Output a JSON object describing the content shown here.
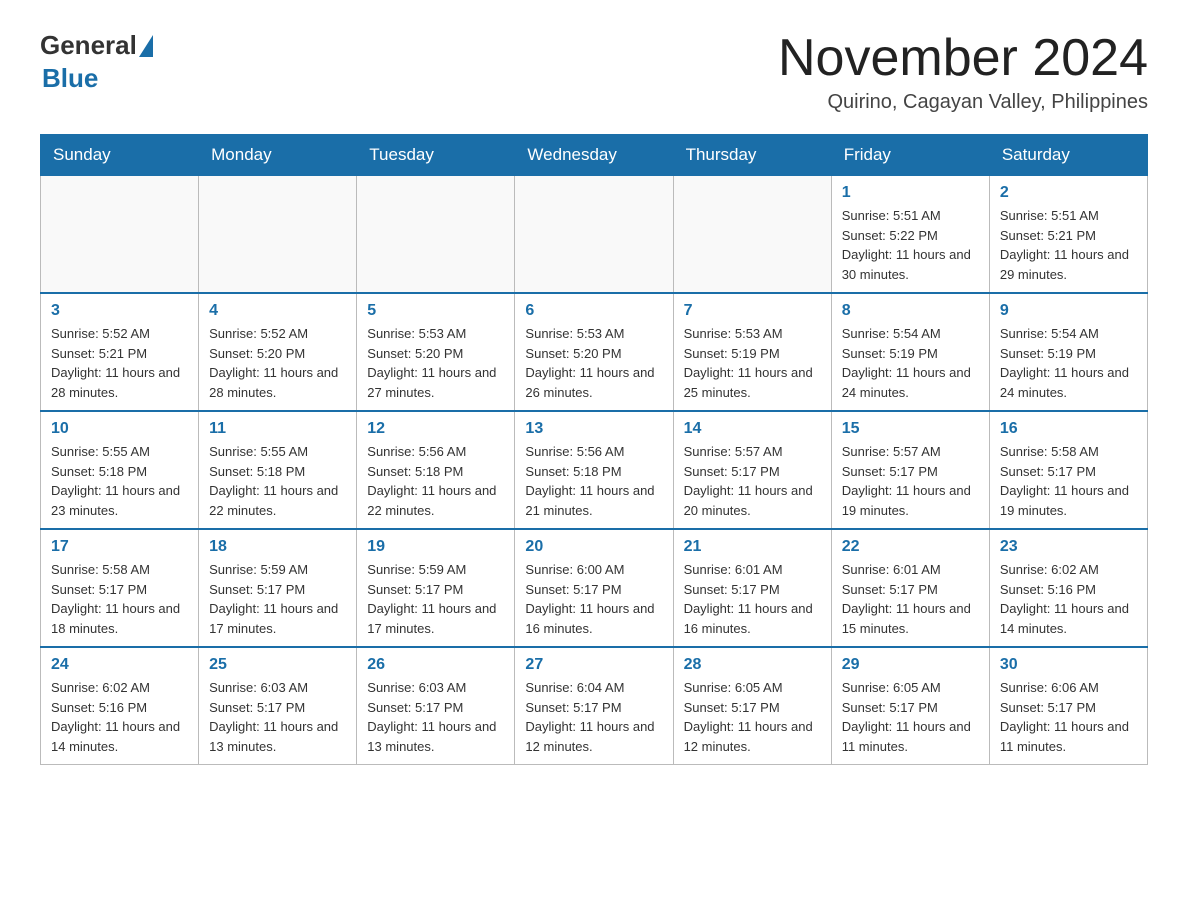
{
  "logo": {
    "general": "General",
    "blue": "Blue"
  },
  "title": "November 2024",
  "location": "Quirino, Cagayan Valley, Philippines",
  "days_of_week": [
    "Sunday",
    "Monday",
    "Tuesday",
    "Wednesday",
    "Thursday",
    "Friday",
    "Saturday"
  ],
  "weeks": [
    {
      "days": [
        {
          "num": "",
          "info": ""
        },
        {
          "num": "",
          "info": ""
        },
        {
          "num": "",
          "info": ""
        },
        {
          "num": "",
          "info": ""
        },
        {
          "num": "",
          "info": ""
        },
        {
          "num": "1",
          "info": "Sunrise: 5:51 AM\nSunset: 5:22 PM\nDaylight: 11 hours and 30 minutes."
        },
        {
          "num": "2",
          "info": "Sunrise: 5:51 AM\nSunset: 5:21 PM\nDaylight: 11 hours and 29 minutes."
        }
      ]
    },
    {
      "days": [
        {
          "num": "3",
          "info": "Sunrise: 5:52 AM\nSunset: 5:21 PM\nDaylight: 11 hours and 28 minutes."
        },
        {
          "num": "4",
          "info": "Sunrise: 5:52 AM\nSunset: 5:20 PM\nDaylight: 11 hours and 28 minutes."
        },
        {
          "num": "5",
          "info": "Sunrise: 5:53 AM\nSunset: 5:20 PM\nDaylight: 11 hours and 27 minutes."
        },
        {
          "num": "6",
          "info": "Sunrise: 5:53 AM\nSunset: 5:20 PM\nDaylight: 11 hours and 26 minutes."
        },
        {
          "num": "7",
          "info": "Sunrise: 5:53 AM\nSunset: 5:19 PM\nDaylight: 11 hours and 25 minutes."
        },
        {
          "num": "8",
          "info": "Sunrise: 5:54 AM\nSunset: 5:19 PM\nDaylight: 11 hours and 24 minutes."
        },
        {
          "num": "9",
          "info": "Sunrise: 5:54 AM\nSunset: 5:19 PM\nDaylight: 11 hours and 24 minutes."
        }
      ]
    },
    {
      "days": [
        {
          "num": "10",
          "info": "Sunrise: 5:55 AM\nSunset: 5:18 PM\nDaylight: 11 hours and 23 minutes."
        },
        {
          "num": "11",
          "info": "Sunrise: 5:55 AM\nSunset: 5:18 PM\nDaylight: 11 hours and 22 minutes."
        },
        {
          "num": "12",
          "info": "Sunrise: 5:56 AM\nSunset: 5:18 PM\nDaylight: 11 hours and 22 minutes."
        },
        {
          "num": "13",
          "info": "Sunrise: 5:56 AM\nSunset: 5:18 PM\nDaylight: 11 hours and 21 minutes."
        },
        {
          "num": "14",
          "info": "Sunrise: 5:57 AM\nSunset: 5:17 PM\nDaylight: 11 hours and 20 minutes."
        },
        {
          "num": "15",
          "info": "Sunrise: 5:57 AM\nSunset: 5:17 PM\nDaylight: 11 hours and 19 minutes."
        },
        {
          "num": "16",
          "info": "Sunrise: 5:58 AM\nSunset: 5:17 PM\nDaylight: 11 hours and 19 minutes."
        }
      ]
    },
    {
      "days": [
        {
          "num": "17",
          "info": "Sunrise: 5:58 AM\nSunset: 5:17 PM\nDaylight: 11 hours and 18 minutes."
        },
        {
          "num": "18",
          "info": "Sunrise: 5:59 AM\nSunset: 5:17 PM\nDaylight: 11 hours and 17 minutes."
        },
        {
          "num": "19",
          "info": "Sunrise: 5:59 AM\nSunset: 5:17 PM\nDaylight: 11 hours and 17 minutes."
        },
        {
          "num": "20",
          "info": "Sunrise: 6:00 AM\nSunset: 5:17 PM\nDaylight: 11 hours and 16 minutes."
        },
        {
          "num": "21",
          "info": "Sunrise: 6:01 AM\nSunset: 5:17 PM\nDaylight: 11 hours and 16 minutes."
        },
        {
          "num": "22",
          "info": "Sunrise: 6:01 AM\nSunset: 5:17 PM\nDaylight: 11 hours and 15 minutes."
        },
        {
          "num": "23",
          "info": "Sunrise: 6:02 AM\nSunset: 5:16 PM\nDaylight: 11 hours and 14 minutes."
        }
      ]
    },
    {
      "days": [
        {
          "num": "24",
          "info": "Sunrise: 6:02 AM\nSunset: 5:16 PM\nDaylight: 11 hours and 14 minutes."
        },
        {
          "num": "25",
          "info": "Sunrise: 6:03 AM\nSunset: 5:17 PM\nDaylight: 11 hours and 13 minutes."
        },
        {
          "num": "26",
          "info": "Sunrise: 6:03 AM\nSunset: 5:17 PM\nDaylight: 11 hours and 13 minutes."
        },
        {
          "num": "27",
          "info": "Sunrise: 6:04 AM\nSunset: 5:17 PM\nDaylight: 11 hours and 12 minutes."
        },
        {
          "num": "28",
          "info": "Sunrise: 6:05 AM\nSunset: 5:17 PM\nDaylight: 11 hours and 12 minutes."
        },
        {
          "num": "29",
          "info": "Sunrise: 6:05 AM\nSunset: 5:17 PM\nDaylight: 11 hours and 11 minutes."
        },
        {
          "num": "30",
          "info": "Sunrise: 6:06 AM\nSunset: 5:17 PM\nDaylight: 11 hours and 11 minutes."
        }
      ]
    }
  ]
}
